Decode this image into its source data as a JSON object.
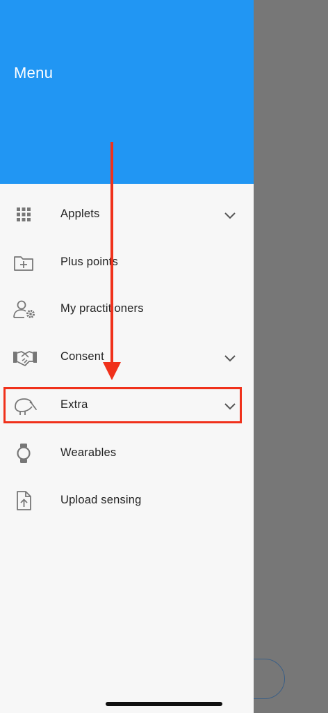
{
  "drawer": {
    "title": "Menu",
    "header_color": "#2196f3",
    "items": [
      {
        "label": "Applets",
        "icon": "grid-icon",
        "expandable": true
      },
      {
        "label": "Plus points",
        "icon": "folder-plus-icon",
        "expandable": false
      },
      {
        "label": "My practitioners",
        "icon": "user-gear-icon",
        "expandable": false
      },
      {
        "label": "Consent",
        "icon": "handshake-icon",
        "expandable": true
      },
      {
        "label": "Extra",
        "icon": "kiwi-bird-icon",
        "expandable": true
      },
      {
        "label": "Wearables",
        "icon": "smartwatch-icon",
        "expandable": false
      },
      {
        "label": "Upload sensing",
        "icon": "file-upload-icon",
        "expandable": false
      }
    ]
  },
  "annotation": {
    "highlight_color": "#f0311b",
    "highlighted_item": "Extra"
  }
}
